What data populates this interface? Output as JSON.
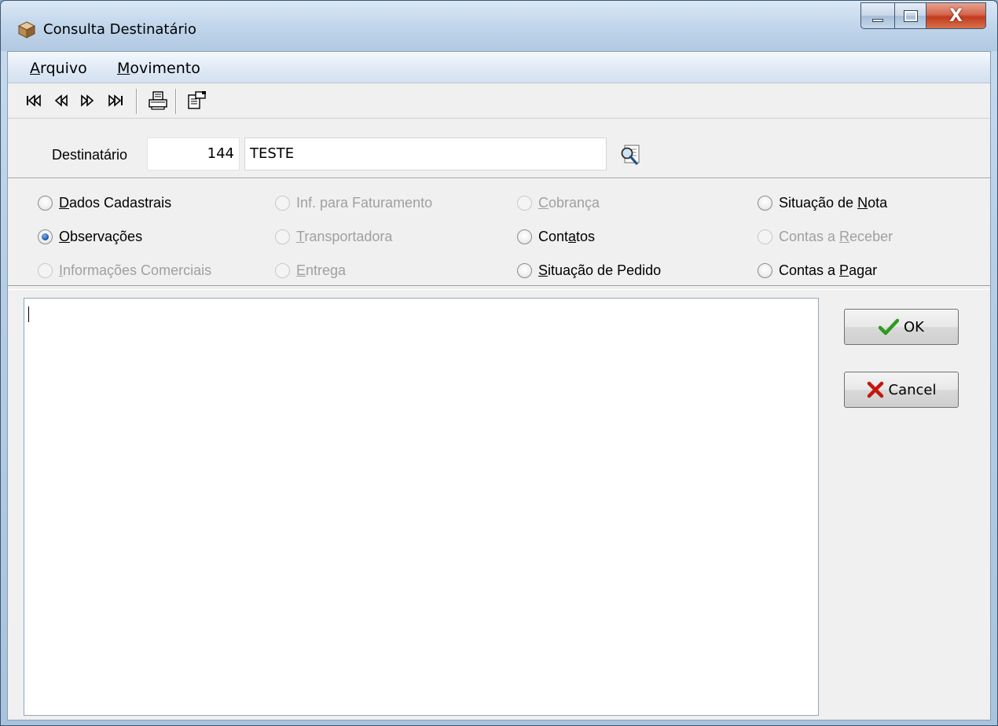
{
  "window": {
    "title": "Consulta Destinatário",
    "app_icon": "cube-icon",
    "controls": {
      "minimize": "minimize-icon",
      "maximize": "maximize-icon",
      "close": "close-icon",
      "close_glyph": "X"
    }
  },
  "menu": {
    "items": [
      {
        "label": "Arquivo",
        "accel": "A",
        "rest": "rquivo"
      },
      {
        "label": "Movimento",
        "accel": "M",
        "rest": "ovimento"
      }
    ]
  },
  "toolbar": {
    "buttons": [
      "first-record-icon",
      "previous-record-icon",
      "next-record-icon",
      "last-record-icon",
      "print-icon",
      "properties-icon"
    ]
  },
  "destinatario": {
    "label": "Destinatário",
    "code": "144",
    "name": "TESTE",
    "lookup_icon": "search-lookup-icon"
  },
  "options": [
    {
      "label": "Dados Cadastrais",
      "accel": "D",
      "rest": "ados Cadastrais",
      "checked": false,
      "enabled": true
    },
    {
      "label": "Inf. para Faturamento",
      "accel": "",
      "rest": "Inf. para Faturamento",
      "checked": false,
      "enabled": false
    },
    {
      "label": "Cobrança",
      "accel": "C",
      "rest": "obrança",
      "checked": false,
      "enabled": false
    },
    {
      "label": "Situação de Nota",
      "pre": "Situação de ",
      "accel": "N",
      "rest": "ota",
      "checked": false,
      "enabled": true
    },
    {
      "label": "Observações",
      "accel": "O",
      "rest": "bservações",
      "checked": true,
      "enabled": true
    },
    {
      "label": "Transportadora",
      "accel": "T",
      "rest": "ransportadora",
      "checked": false,
      "enabled": false
    },
    {
      "label": "Contatos",
      "pre": "Cont",
      "accel": "a",
      "rest": "tos",
      "checked": false,
      "enabled": true
    },
    {
      "label": "Contas a Receber",
      "pre": "Contas a ",
      "accel": "R",
      "rest": "eceber",
      "checked": false,
      "enabled": false
    },
    {
      "label": "Informações Comerciais",
      "accel": "I",
      "rest": "nformações Comerciais",
      "checked": false,
      "enabled": false
    },
    {
      "label": "Entrega",
      "accel": "E",
      "rest": "ntrega",
      "checked": false,
      "enabled": false
    },
    {
      "label": "Situação de Pedido",
      "accel": "S",
      "rest": "ituação de Pedido",
      "checked": false,
      "enabled": true
    },
    {
      "label": "Contas a Pagar",
      "pre": "Contas a ",
      "accel": "P",
      "rest": "agar",
      "checked": false,
      "enabled": true
    }
  ],
  "memo": {
    "value": ""
  },
  "buttons": {
    "ok": {
      "label": "OK",
      "icon": "checkmark-icon",
      "color": "#2e9a1e"
    },
    "cancel": {
      "label": "Cancel",
      "icon": "x-mark-icon",
      "color": "#c4160f"
    }
  }
}
